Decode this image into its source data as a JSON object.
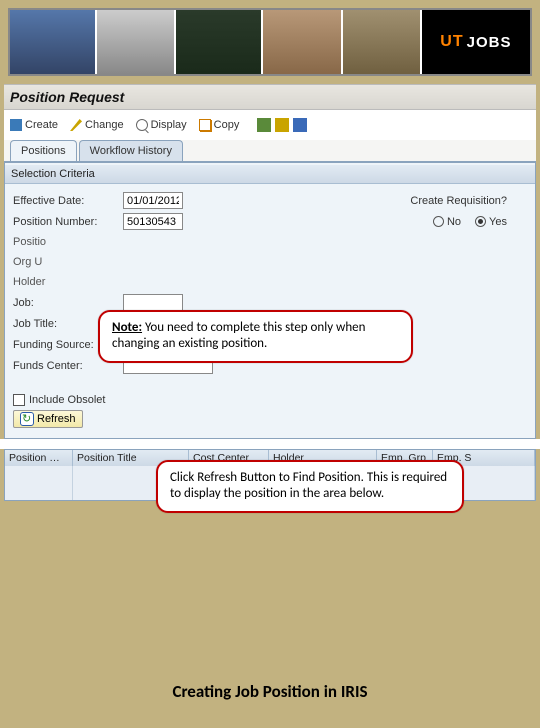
{
  "banner": {
    "logo_text": "JOBS",
    "logo_prefix": "UT"
  },
  "panel_title": "Position Request",
  "toolbar": {
    "create": "Create",
    "change": "Change",
    "display": "Display",
    "copy": "Copy"
  },
  "tabs": {
    "positions": "Positions",
    "workflow": "Workflow History"
  },
  "section_title": "Selection Criteria",
  "fields": {
    "effective_date_label": "Effective Date:",
    "effective_date_value": "01/01/2012",
    "position_number_label": "Position Number:",
    "position_number_value": "50130543",
    "create_req_label": "Create Requisition?",
    "radio_no": "No",
    "radio_yes": "Yes",
    "position_label": "Positio",
    "org_label": "Org U",
    "holder_label": "Holder",
    "job_label": "Job:",
    "job_title_label": "Job Title:",
    "funding_source_label": "Funding Source:",
    "funds_center_label": "Funds Center:"
  },
  "include_obsolete": "Include Obsolet",
  "refresh_label": "Refresh",
  "callout1": {
    "note": "Note:",
    "text": " You need to complete this step only when changing an existing position."
  },
  "callout2": {
    "text": "Click Refresh Button to Find Position. This is required to display the position in the area below."
  },
  "table": {
    "headers": {
      "c1": "Position …",
      "c2": "Position Title",
      "c3": "Cost Center",
      "c4": "Holder",
      "c5": "Emp. Grp",
      "c6": "Emp. S"
    }
  },
  "footer": "Creating Job Position in IRIS"
}
